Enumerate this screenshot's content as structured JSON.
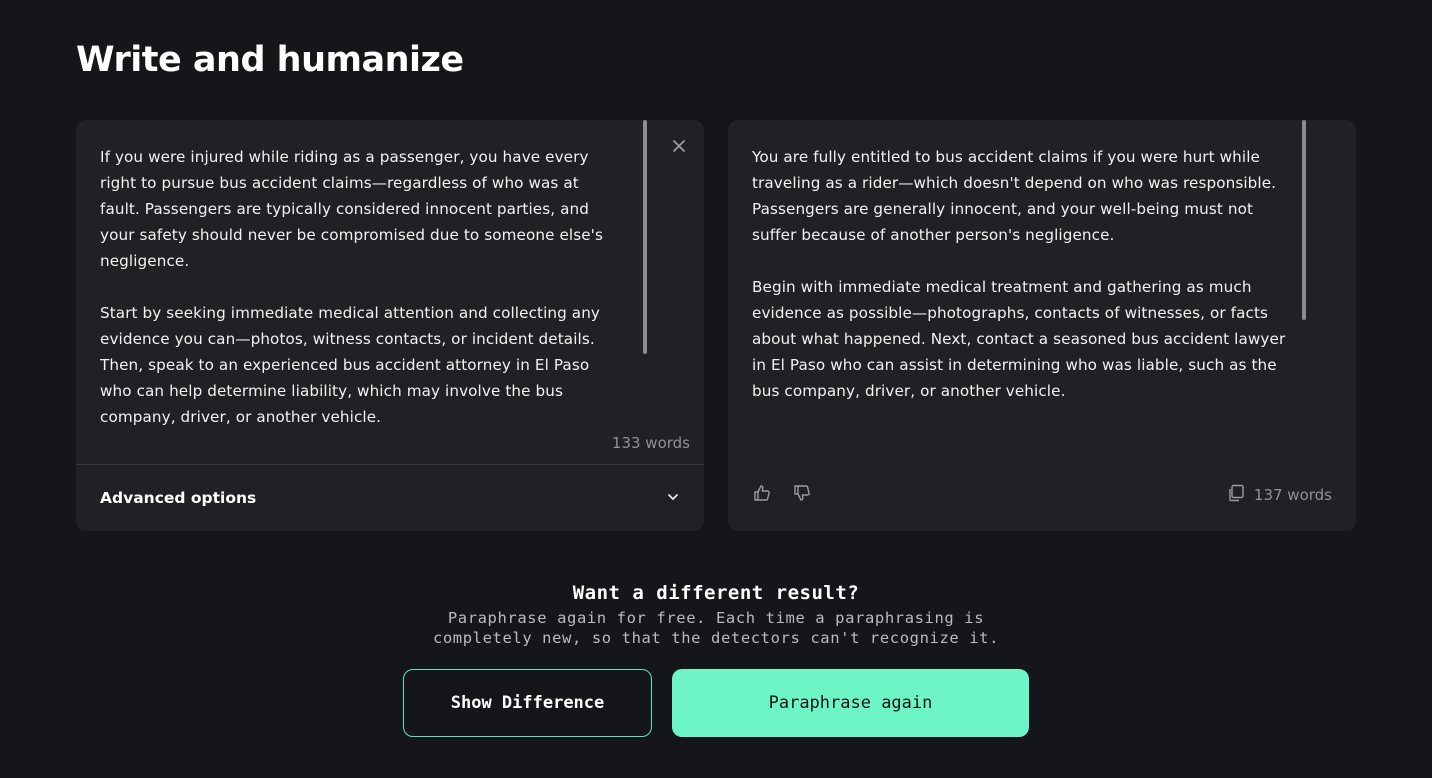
{
  "page": {
    "title": "Write and humanize"
  },
  "input_panel": {
    "text": "If you were injured while riding as a passenger, you have every right to pursue bus accident claims—regardless of who was at fault. Passengers are typically considered innocent parties, and your safety should never be compromised due to someone else's negligence.\n\nStart by seeking immediate medical attention and collecting any evidence you can—photos, witness contacts, or incident details. Then, speak to an experienced bus accident attorney in El Paso who can help determine liability, which may involve the bus company, driver, or another vehicle.",
    "word_count": "133 words",
    "close_icon": "close-icon",
    "advanced_options_label": "Advanced options",
    "advanced_options_icon": "chevron-down-icon"
  },
  "output_panel": {
    "text": "You are fully entitled to bus accident claims if you were hurt while traveling as a rider—which doesn't depend on who was responsible. Passengers are generally innocent, and your well-being must not suffer because of another person's negligence.\n\nBegin with immediate medical treatment and gathering as much evidence as possible—photographs, contacts of witnesses, or facts about what happened. Next, contact a seasoned bus accident lawyer in El Paso who can assist in determining who was liable, such as the bus company, driver, or another vehicle.",
    "word_count": "137 words",
    "thumbs_up_icon": "thumbs-up-icon",
    "thumbs_down_icon": "thumbs-down-icon",
    "copy_icon": "copy-icon"
  },
  "cta": {
    "title": "Want a different result?",
    "subtitle_line1": "Paraphrase again for free. Each time a paraphrasing is",
    "subtitle_line2": "completely new, so that the detectors can't recognize it.",
    "show_difference_label": "Show Difference",
    "paraphrase_again_label": "Paraphrase again"
  },
  "colors": {
    "background": "#151619",
    "panel": "#1f2124",
    "accent": "#6df5c5"
  }
}
